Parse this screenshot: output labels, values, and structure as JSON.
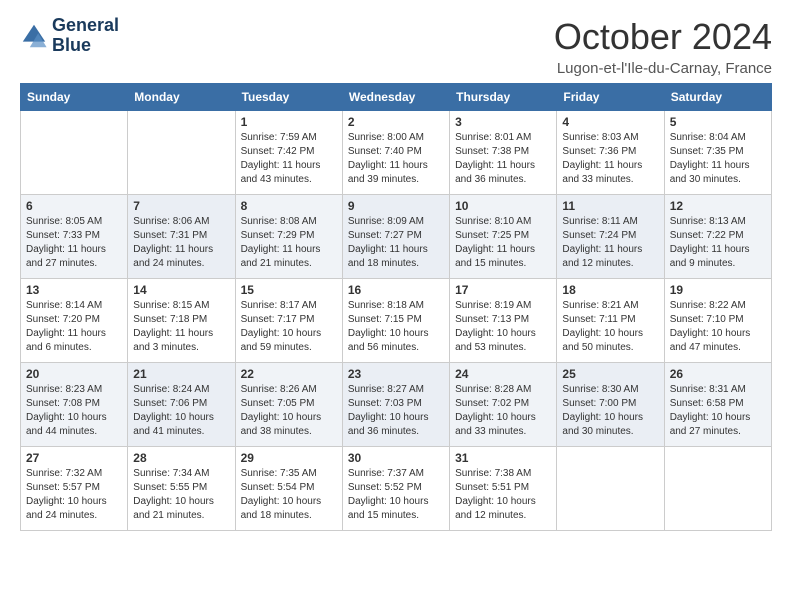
{
  "header": {
    "logo_line1": "General",
    "logo_line2": "Blue",
    "month_title": "October 2024",
    "location": "Lugon-et-l'Ile-du-Carnay, France"
  },
  "days_of_week": [
    "Sunday",
    "Monday",
    "Tuesday",
    "Wednesday",
    "Thursday",
    "Friday",
    "Saturday"
  ],
  "weeks": [
    [
      {
        "day": "",
        "content": ""
      },
      {
        "day": "",
        "content": ""
      },
      {
        "day": "1",
        "content": "Sunrise: 7:59 AM\nSunset: 7:42 PM\nDaylight: 11 hours and 43 minutes."
      },
      {
        "day": "2",
        "content": "Sunrise: 8:00 AM\nSunset: 7:40 PM\nDaylight: 11 hours and 39 minutes."
      },
      {
        "day": "3",
        "content": "Sunrise: 8:01 AM\nSunset: 7:38 PM\nDaylight: 11 hours and 36 minutes."
      },
      {
        "day": "4",
        "content": "Sunrise: 8:03 AM\nSunset: 7:36 PM\nDaylight: 11 hours and 33 minutes."
      },
      {
        "day": "5",
        "content": "Sunrise: 8:04 AM\nSunset: 7:35 PM\nDaylight: 11 hours and 30 minutes."
      }
    ],
    [
      {
        "day": "6",
        "content": "Sunrise: 8:05 AM\nSunset: 7:33 PM\nDaylight: 11 hours and 27 minutes."
      },
      {
        "day": "7",
        "content": "Sunrise: 8:06 AM\nSunset: 7:31 PM\nDaylight: 11 hours and 24 minutes."
      },
      {
        "day": "8",
        "content": "Sunrise: 8:08 AM\nSunset: 7:29 PM\nDaylight: 11 hours and 21 minutes."
      },
      {
        "day": "9",
        "content": "Sunrise: 8:09 AM\nSunset: 7:27 PM\nDaylight: 11 hours and 18 minutes."
      },
      {
        "day": "10",
        "content": "Sunrise: 8:10 AM\nSunset: 7:25 PM\nDaylight: 11 hours and 15 minutes."
      },
      {
        "day": "11",
        "content": "Sunrise: 8:11 AM\nSunset: 7:24 PM\nDaylight: 11 hours and 12 minutes."
      },
      {
        "day": "12",
        "content": "Sunrise: 8:13 AM\nSunset: 7:22 PM\nDaylight: 11 hours and 9 minutes."
      }
    ],
    [
      {
        "day": "13",
        "content": "Sunrise: 8:14 AM\nSunset: 7:20 PM\nDaylight: 11 hours and 6 minutes."
      },
      {
        "day": "14",
        "content": "Sunrise: 8:15 AM\nSunset: 7:18 PM\nDaylight: 11 hours and 3 minutes."
      },
      {
        "day": "15",
        "content": "Sunrise: 8:17 AM\nSunset: 7:17 PM\nDaylight: 10 hours and 59 minutes."
      },
      {
        "day": "16",
        "content": "Sunrise: 8:18 AM\nSunset: 7:15 PM\nDaylight: 10 hours and 56 minutes."
      },
      {
        "day": "17",
        "content": "Sunrise: 8:19 AM\nSunset: 7:13 PM\nDaylight: 10 hours and 53 minutes."
      },
      {
        "day": "18",
        "content": "Sunrise: 8:21 AM\nSunset: 7:11 PM\nDaylight: 10 hours and 50 minutes."
      },
      {
        "day": "19",
        "content": "Sunrise: 8:22 AM\nSunset: 7:10 PM\nDaylight: 10 hours and 47 minutes."
      }
    ],
    [
      {
        "day": "20",
        "content": "Sunrise: 8:23 AM\nSunset: 7:08 PM\nDaylight: 10 hours and 44 minutes."
      },
      {
        "day": "21",
        "content": "Sunrise: 8:24 AM\nSunset: 7:06 PM\nDaylight: 10 hours and 41 minutes."
      },
      {
        "day": "22",
        "content": "Sunrise: 8:26 AM\nSunset: 7:05 PM\nDaylight: 10 hours and 38 minutes."
      },
      {
        "day": "23",
        "content": "Sunrise: 8:27 AM\nSunset: 7:03 PM\nDaylight: 10 hours and 36 minutes."
      },
      {
        "day": "24",
        "content": "Sunrise: 8:28 AM\nSunset: 7:02 PM\nDaylight: 10 hours and 33 minutes."
      },
      {
        "day": "25",
        "content": "Sunrise: 8:30 AM\nSunset: 7:00 PM\nDaylight: 10 hours and 30 minutes."
      },
      {
        "day": "26",
        "content": "Sunrise: 8:31 AM\nSunset: 6:58 PM\nDaylight: 10 hours and 27 minutes."
      }
    ],
    [
      {
        "day": "27",
        "content": "Sunrise: 7:32 AM\nSunset: 5:57 PM\nDaylight: 10 hours and 24 minutes."
      },
      {
        "day": "28",
        "content": "Sunrise: 7:34 AM\nSunset: 5:55 PM\nDaylight: 10 hours and 21 minutes."
      },
      {
        "day": "29",
        "content": "Sunrise: 7:35 AM\nSunset: 5:54 PM\nDaylight: 10 hours and 18 minutes."
      },
      {
        "day": "30",
        "content": "Sunrise: 7:37 AM\nSunset: 5:52 PM\nDaylight: 10 hours and 15 minutes."
      },
      {
        "day": "31",
        "content": "Sunrise: 7:38 AM\nSunset: 5:51 PM\nDaylight: 10 hours and 12 minutes."
      },
      {
        "day": "",
        "content": ""
      },
      {
        "day": "",
        "content": ""
      }
    ]
  ]
}
